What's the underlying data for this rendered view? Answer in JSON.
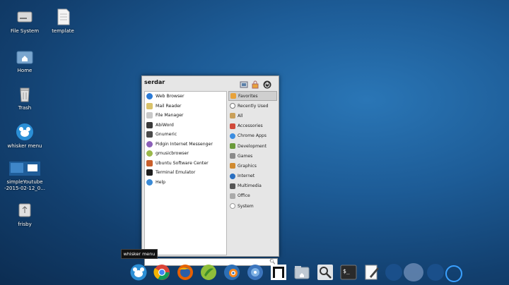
{
  "desktop": {
    "icons": [
      {
        "label": "File System"
      },
      {
        "label": "template"
      },
      {
        "label": "Home"
      },
      {
        "label": "Trash"
      },
      {
        "label": "whisker menu"
      },
      {
        "label": "simpleYoutube\n-2015-02-12_0..."
      },
      {
        "label": "frisby"
      }
    ]
  },
  "menu": {
    "username": "serdar",
    "favorites": [
      {
        "label": "Web Browser",
        "color": "#2b7ad6"
      },
      {
        "label": "Mail Reader",
        "color": "#d9c26a"
      },
      {
        "label": "File Manager",
        "color": "#c8c8c8"
      },
      {
        "label": "AbiWord",
        "color": "#3a3a3a"
      },
      {
        "label": "Gnumeric",
        "color": "#4a4a4a"
      },
      {
        "label": "Pidgin Internet Messenger",
        "color": "#8b5fb8"
      },
      {
        "label": "gmusicbrowser",
        "color": "#9ab84a"
      },
      {
        "label": "Ubuntu Software Center",
        "color": "#c95f2b"
      },
      {
        "label": "Terminal Emulator",
        "color": "#1e1e1e"
      },
      {
        "label": "Help",
        "color": "#3a8ad6"
      }
    ],
    "categories": [
      {
        "label": "Favorites",
        "color": "#e8a23a"
      },
      {
        "label": "Recently Used",
        "color": "#777777"
      },
      {
        "label": "All",
        "color": "#c9a05a"
      },
      {
        "label": "Accessories",
        "color": "#d04a3a"
      },
      {
        "label": "Chrome Apps",
        "color": "#3b8de0"
      },
      {
        "label": "Development",
        "color": "#6a9a3a"
      },
      {
        "label": "Games",
        "color": "#8a8a8a"
      },
      {
        "label": "Graphics",
        "color": "#d08a30"
      },
      {
        "label": "Internet",
        "color": "#2a6fc0"
      },
      {
        "label": "Multimedia",
        "color": "#555555"
      },
      {
        "label": "Office",
        "color": "#aaaaaa"
      },
      {
        "label": "System",
        "color": "#aaaaaa"
      }
    ],
    "search": {
      "placeholder": ""
    }
  },
  "tooltip": {
    "text": "whisker menu"
  }
}
